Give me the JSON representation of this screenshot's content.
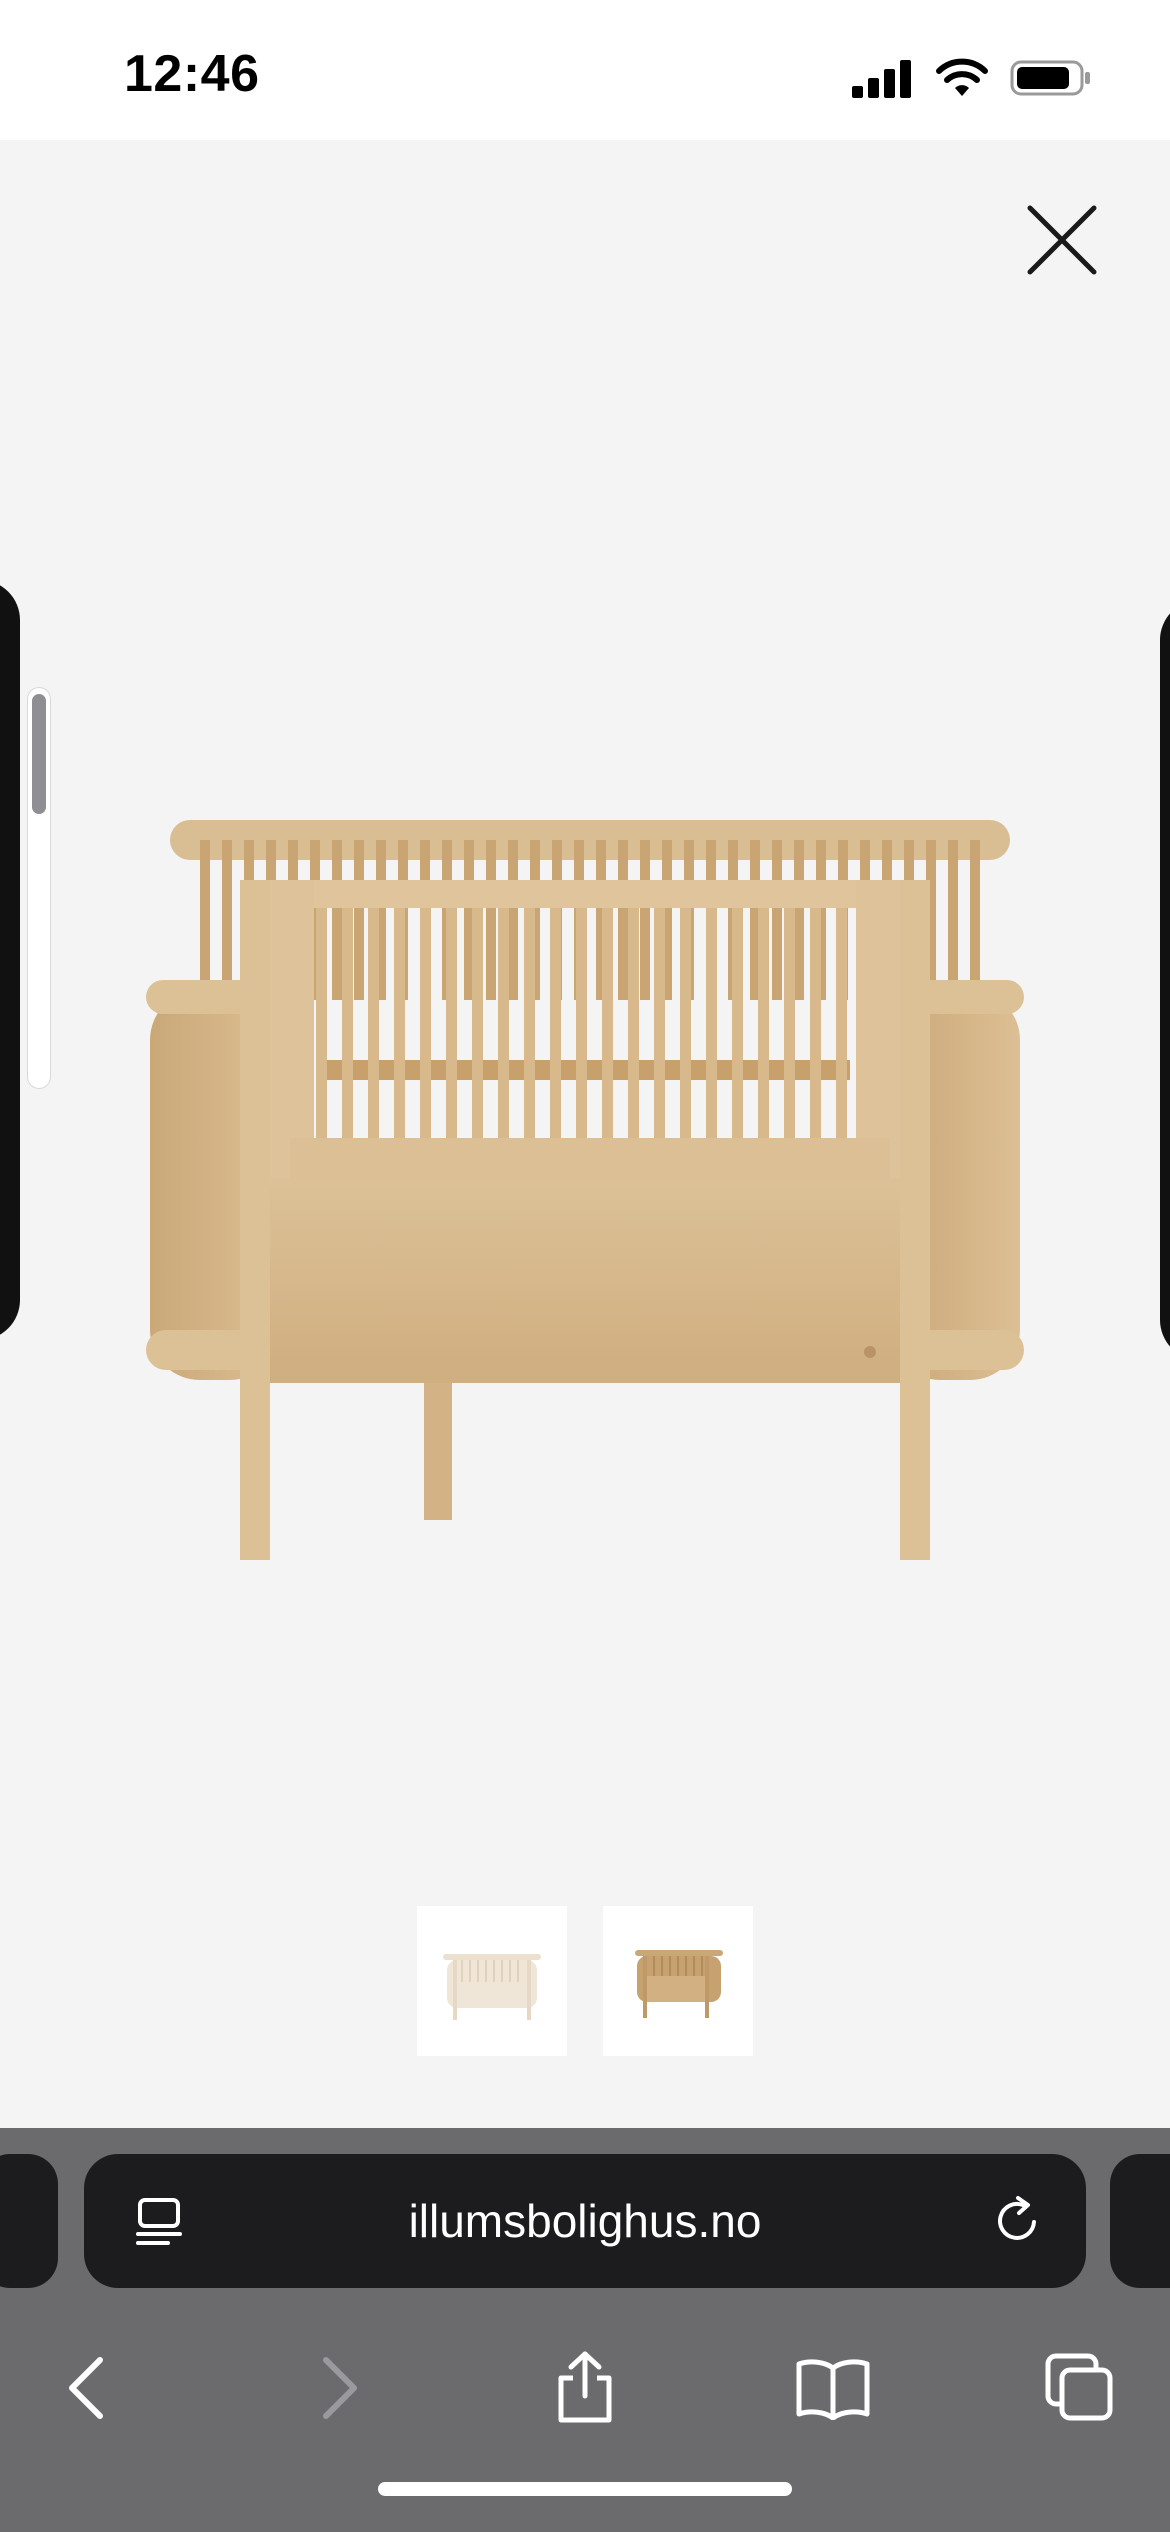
{
  "status_bar": {
    "time": "12:46",
    "icons": [
      "cellular-signal-icon",
      "wifi-icon",
      "battery-icon"
    ]
  },
  "viewer": {
    "close_icon": "close-icon",
    "main_image": "baby-crib-natural-wood",
    "thumbnails": [
      "crib-thumbnail-light",
      "crib-thumbnail-natural"
    ]
  },
  "browser": {
    "url": "illumsbolighus.no",
    "toolbar": [
      "back-icon",
      "forward-icon",
      "share-icon",
      "bookmarks-icon",
      "tabs-icon"
    ]
  },
  "colors": {
    "viewer_bg": "#f4f4f5",
    "wood": "#d8b98e",
    "chrome_bg": "#6b6b6e",
    "url_bg": "#1c1c1e"
  }
}
